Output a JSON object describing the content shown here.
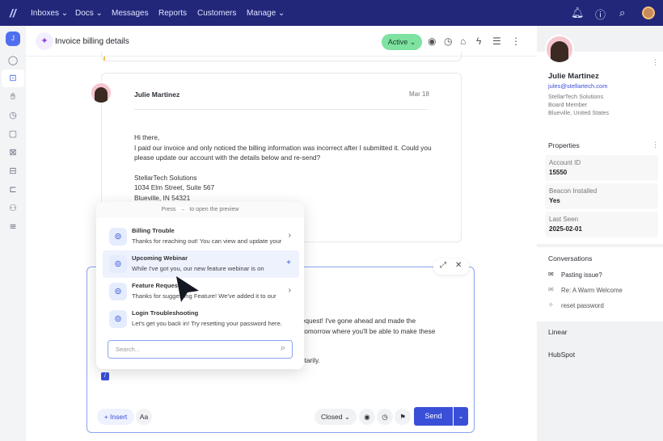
{
  "topnav": {
    "items": [
      "Inboxes ⌄",
      "Docs ⌄",
      "Messages",
      "Reports",
      "Customers",
      "Manage ⌄"
    ]
  },
  "sidebar": {
    "avatar_initial": "J"
  },
  "header": {
    "title": "Invoice billing details",
    "status": "Active ⌄"
  },
  "message": {
    "author": "Julie Martinez",
    "date": "Mar 18",
    "greeting": "Hi there,",
    "body": "I paid our invoice and only noticed the billing information was  incorrect after I submitted it. Could you please update our account with the details below and re-send?",
    "address": [
      "StellarTech Solutions",
      "1034 Elm Street, Suite 567",
      "Blueville, IN 54321"
    ]
  },
  "popup": {
    "hint_pre": "Press",
    "hint_key": "→",
    "hint_post": "to open the preview",
    "items": [
      {
        "title": "Billing Trouble",
        "desc": "Thanks for reaching out! You can view and update your",
        "action": "›"
      },
      {
        "title": "Upcoming Webinar",
        "desc": "While I've got you, our new feature webinar is on",
        "action": "+"
      },
      {
        "title": "Feature Request",
        "desc": "Thanks for suggesting Feature! We've added it to our",
        "action": "›"
      },
      {
        "title": "Login Troubleshooting",
        "desc": "Let's get you back in! Try resetting your password here.",
        "action": ""
      }
    ],
    "search_placeholder": "Search..."
  },
  "editor": {
    "lines": [
      "request! I've gone ahead and made the",
      "tomorrow where you'll be able to make these",
      "ntarily."
    ],
    "slash": "/",
    "insert": "+ Insert",
    "format": "Aa",
    "status": "Closed ⌄",
    "send": "Send"
  },
  "contact": {
    "name": "Julie Martinez",
    "email": "jules@stellartech.com",
    "company": "StellarTech Solutions",
    "role": "Board Member",
    "location": "Blueville, United States"
  },
  "properties": {
    "title": "Properties",
    "items": [
      {
        "label": "Account ID",
        "value": "15550"
      },
      {
        "label": "Beacon Installed",
        "value": "Yes"
      },
      {
        "label": "Last Seen",
        "value": "2025-02-01"
      }
    ]
  },
  "conversations": {
    "title": "Conversations",
    "items": [
      "Pasting issue?",
      "Re: A Warm Welcome",
      "reset password"
    ]
  },
  "integrations": [
    "Linear",
    "HubSpot"
  ]
}
